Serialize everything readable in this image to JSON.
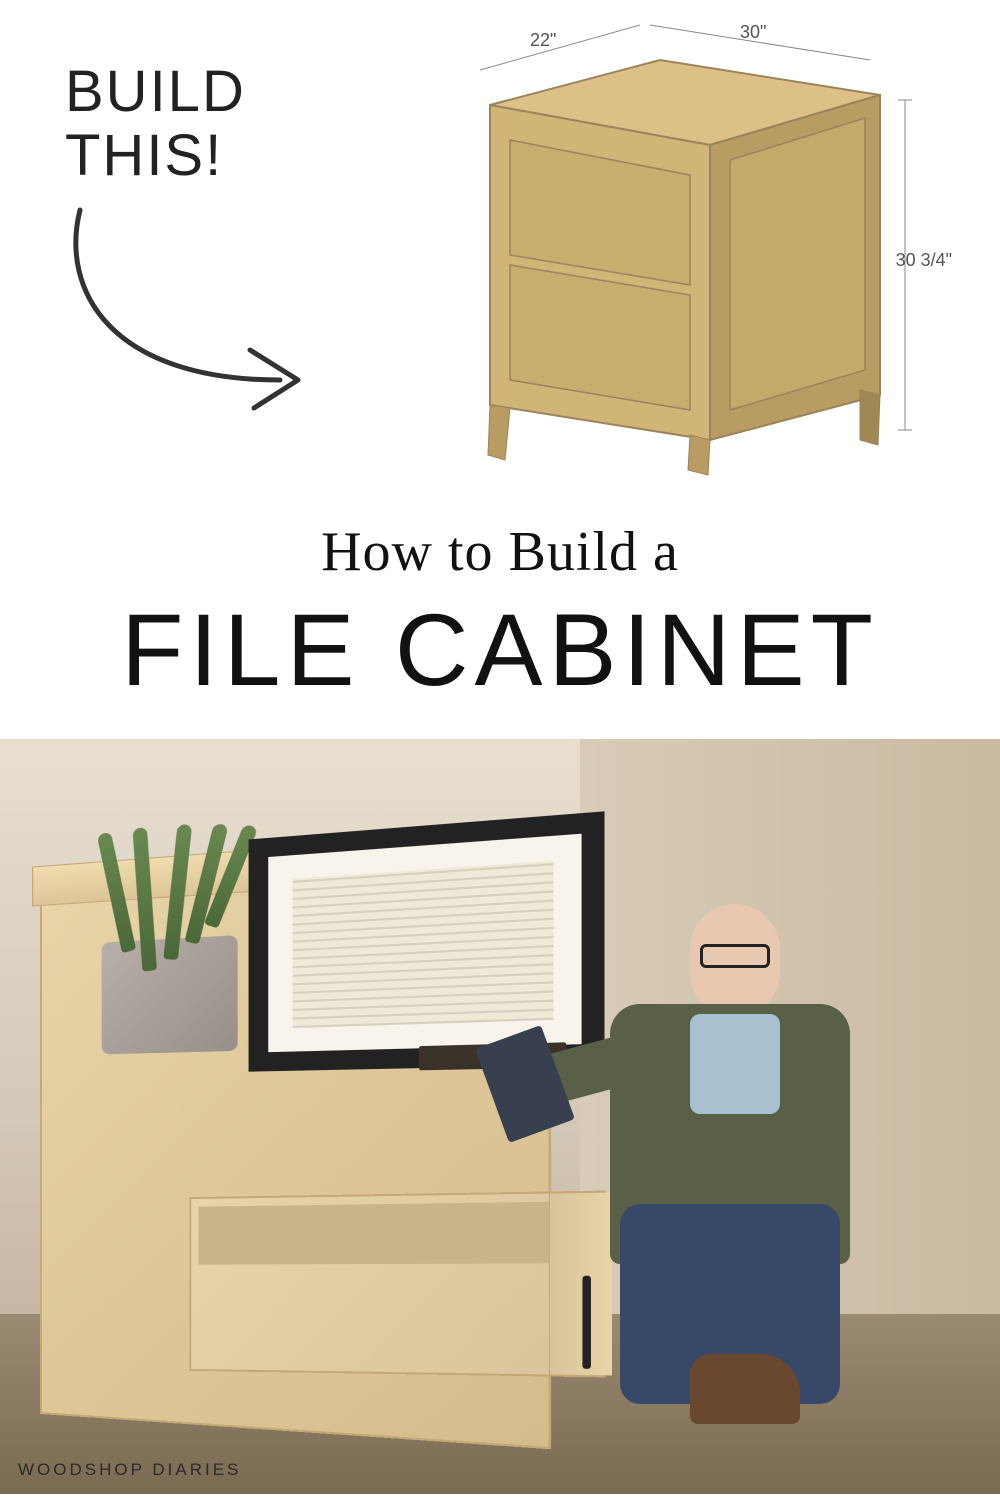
{
  "callout": {
    "line1": "BUILD",
    "line2": "THIS!"
  },
  "dimensions": {
    "depth": "22\"",
    "width": "30\"",
    "height": "30 3/4\""
  },
  "title": {
    "line1": "How to Build a",
    "line2": "FILE CABINET"
  },
  "watermark": "WOODSHOP DIARIES",
  "colors": {
    "wood_light": "#e8d4a8",
    "wood_mid": "#d4bc8c",
    "wood_dark": "#c4a878",
    "text": "#111111"
  }
}
